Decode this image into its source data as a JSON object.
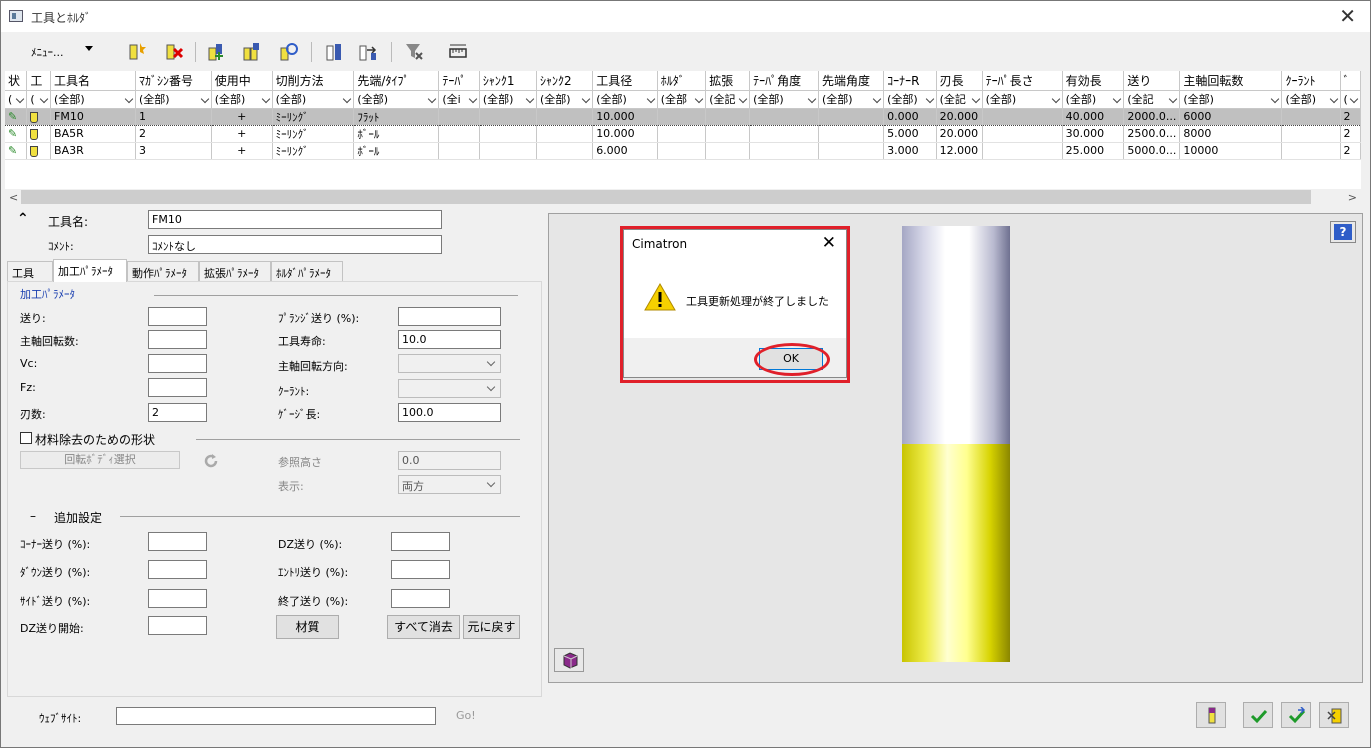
{
  "window": {
    "title": "工具とﾎﾙﾀﾞ",
    "close": "✕"
  },
  "toolbar": {
    "menu_label": "ﾒﾆｭｰ..."
  },
  "grid": {
    "columns": [
      "状",
      "工",
      "工具名",
      "ﾏｶﾞｼﾝ番号",
      "使用中",
      "切削方法",
      "先端/ﾀｲﾌﾟ",
      "ﾃｰﾊﾟ",
      "ｼｬﾝｸ1",
      "ｼｬﾝｸ2",
      "工具径",
      "ﾎﾙﾀﾞ",
      "拡張",
      "ﾃｰﾊﾟ角度",
      "先端角度",
      "ｺｰﾅｰR",
      "刃長",
      "ﾃｰﾊﾟ長さ",
      "有効長",
      "送り",
      "主軸回転数",
      "ｸｰﾗﾝﾄ",
      "ﾞ"
    ],
    "filters": [
      "(",
      "(",
      "(全部)",
      "(全部)",
      "(全部)",
      "(全部)",
      "(全部)",
      "(全i",
      "(全部)",
      "(全部)",
      "(全部)",
      "(全部",
      "(全記",
      "(全部)",
      "(全部)",
      "(全部)",
      "(全記",
      "(全部)",
      "(全部)",
      "(全記",
      "(全部)",
      "(全部)",
      "("
    ],
    "rows": [
      [
        "",
        "",
        "FM10",
        "1",
        "+",
        "ﾐｰﾘﾝｸﾞ",
        "ﾌﾗｯﾄ",
        "",
        "",
        "",
        "10.000",
        "",
        "",
        "",
        "",
        "0.000",
        "20.000",
        "",
        "40.000",
        "2000.0...",
        "6000",
        "",
        "2"
      ],
      [
        "",
        "",
        "BA5R",
        "2",
        "+",
        "ﾐｰﾘﾝｸﾞ",
        "ﾎﾞｰﾙ",
        "",
        "",
        "",
        "10.000",
        "",
        "",
        "",
        "",
        "5.000",
        "20.000",
        "",
        "30.000",
        "2500.0...",
        "8000",
        "",
        "2"
      ],
      [
        "",
        "",
        "BA3R",
        "3",
        "+",
        "ﾐｰﾘﾝｸﾞ",
        "ﾎﾞｰﾙ",
        "",
        "",
        "",
        "6.000",
        "",
        "",
        "",
        "",
        "3.000",
        "12.000",
        "",
        "25.000",
        "5000.0...",
        "10000",
        "",
        "2"
      ]
    ],
    "scroll_left": "<",
    "scroll_right": ">"
  },
  "header_fields": {
    "tool_name_label": "工具名:",
    "tool_name_value": "FM10",
    "comment_label": "ｺﾒﾝﾄ:",
    "comment_value": "ｺﾒﾝﾄなし",
    "collapse_icon": "⌃"
  },
  "tabs": [
    "工具",
    "加工ﾊﾟﾗﾒｰﾀ",
    "動作ﾊﾟﾗﾒｰﾀ",
    "拡張ﾊﾟﾗﾒｰﾀ",
    "ﾎﾙﾀﾞﾊﾟﾗﾒｰﾀ"
  ],
  "params": {
    "group_title": "加工ﾊﾟﾗﾒｰﾀ",
    "feed_label": "送り:",
    "feed_value": "",
    "spindle_label": "主軸回転数:",
    "spindle_value": "",
    "vc_label": "Vc:",
    "vc_value": "",
    "fz_label": "Fz:",
    "fz_value": "",
    "flutes_label": "刃数:",
    "flutes_value": "2",
    "plunge_label": "ﾌﾟﾗﾝｼﾞ送り (%):",
    "plunge_value": "",
    "life_label": "工具寿命:",
    "life_value": "10.0",
    "direction_label": "主軸回転方向:",
    "direction_value": "",
    "coolant_label": "ｸｰﾗﾝﾄ:",
    "coolant_value": "",
    "gauge_label": "ｹﾞｰｼﾞ長:",
    "gauge_value": "100.0",
    "remove_shape_label": "材料除去のための形状",
    "rotate_body_button": "回転ﾎﾞﾃﾞｨ選択",
    "ref_height_label": "参照高さ",
    "ref_height_value": "0.0",
    "display_label": "表示:",
    "display_value": "両方"
  },
  "extra": {
    "toggle": "–",
    "title": "追加設定",
    "corner_label": "ｺｰﾅｰ送り (%):",
    "down_label": "ﾀﾞｳﾝ送り (%):",
    "side_label": "ｻｲﾄﾞ送り (%):",
    "dz_start_label": "DZ送り開始:",
    "dz_label": "DZ送り (%):",
    "entry_label": "ｴﾝﾄﾘ送り (%):",
    "exit_label": "終了送り (%):",
    "material_button": "材質",
    "clear_all_button": "すべて消去",
    "undo_button": "元に戻す"
  },
  "footer": {
    "website_label": "ｳｪﾌﾞｻｲﾄ:",
    "website_value": "",
    "go_label": "Go!"
  },
  "preview": {
    "help": "?"
  },
  "dialog": {
    "title": "Cimatron",
    "close": "✕",
    "message": "工具更新処理が終了しました",
    "ok": "OK"
  },
  "colors": {
    "annotation": "#e0202a",
    "ok_border": "#0078d7",
    "link": "#1a3fb0"
  }
}
